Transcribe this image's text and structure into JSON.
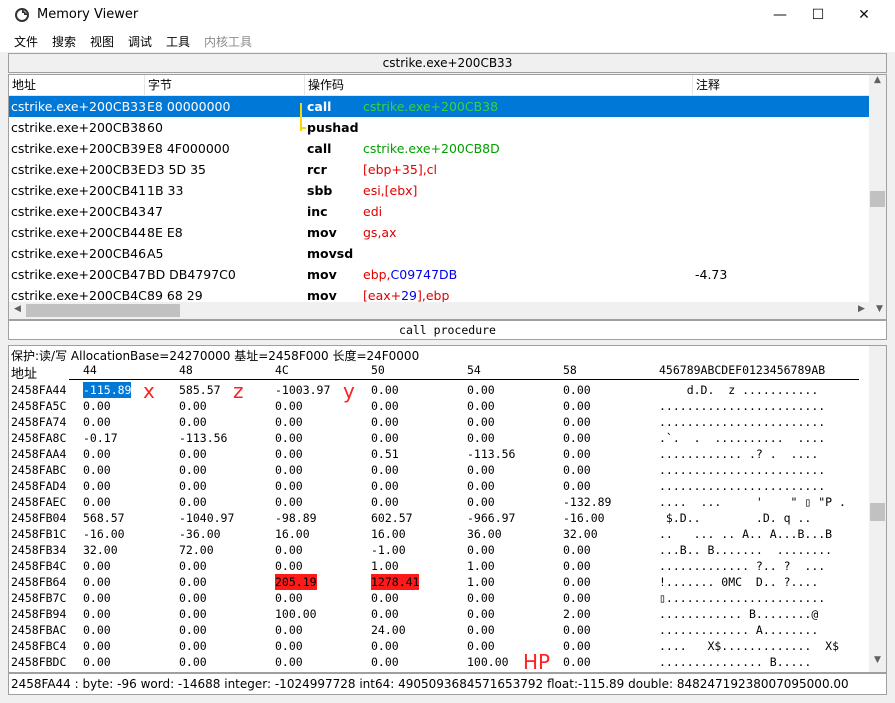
{
  "window": {
    "title": "Memory Viewer",
    "minimize": "—",
    "maximize": "☐",
    "close": "✕"
  },
  "menu": [
    "文件",
    "搜索",
    "视图",
    "调试",
    "工具",
    "内核工具"
  ],
  "disasm": {
    "current_address": "cstrike.exe+200CB33",
    "columns": [
      "地址",
      "字节",
      "操作码",
      "注释"
    ],
    "rows": [
      {
        "addr": "cstrike.exe+200CB33",
        "bytes": "E8 00000000",
        "op": "call",
        "args": "cstrike.exe+200CB38",
        "comment": ""
      },
      {
        "addr": "cstrike.exe+200CB38",
        "bytes": "60",
        "op": "pushad",
        "args": "",
        "comment": ""
      },
      {
        "addr": "cstrike.exe+200CB39",
        "bytes": "E8 4F000000",
        "op": "call",
        "args": "cstrike.exe+200CB8D",
        "comment": ""
      },
      {
        "addr": "cstrike.exe+200CB3E",
        "bytes": "D3 5D 35",
        "op": "rcr",
        "args": "[ebp+35],cl",
        "comment": ""
      },
      {
        "addr": "cstrike.exe+200CB41",
        "bytes": "1B 33",
        "op": "sbb",
        "args": "esi,[ebx]",
        "comment": ""
      },
      {
        "addr": "cstrike.exe+200CB43",
        "bytes": "47",
        "op": "inc",
        "args": "edi",
        "comment": ""
      },
      {
        "addr": "cstrike.exe+200CB44",
        "bytes": "8E E8",
        "op": "mov",
        "args": "gs,ax",
        "comment": ""
      },
      {
        "addr": "cstrike.exe+200CB46",
        "bytes": "A5",
        "op": "movsd",
        "args": "",
        "comment": ""
      },
      {
        "addr": "cstrike.exe+200CB47",
        "bytes": "BD DB4797C0",
        "op": "mov",
        "args": "ebp,C09747DB",
        "comment": "-4.73"
      },
      {
        "addr": "cstrike.exe+200CB4C",
        "bytes": "89 68 29",
        "op": "mov",
        "args": "[eax+29],ebp",
        "comment": ""
      }
    ],
    "status": "call procedure"
  },
  "hex": {
    "info": "保护:读/写  AllocationBase=24270000 基址=2458F000 长度=24F0000",
    "header_label": "地址",
    "header_cols": [
      "44",
      "48",
      "4C",
      "50",
      "54",
      "58"
    ],
    "ascii_header": "456789ABCDEF0123456789AB",
    "rows": [
      {
        "addr": "2458FA44",
        "v": [
          "-115.89",
          "585.57",
          "-1003.97",
          "0.00",
          "0.00",
          "0.00"
        ],
        "ascii": "    d.D.  z ..........."
      },
      {
        "addr": "2458FA5C",
        "v": [
          "0.00",
          "0.00",
          "0.00",
          "0.00",
          "0.00",
          "0.00"
        ],
        "ascii": "........................"
      },
      {
        "addr": "2458FA74",
        "v": [
          "0.00",
          "0.00",
          "0.00",
          "0.00",
          "0.00",
          "0.00"
        ],
        "ascii": "........................"
      },
      {
        "addr": "2458FA8C",
        "v": [
          "-0.17",
          "-113.56",
          "0.00",
          "0.00",
          "0.00",
          "0.00"
        ],
        "ascii": ".`.  .  ..........  ...."
      },
      {
        "addr": "2458FAA4",
        "v": [
          "0.00",
          "0.00",
          "0.00",
          "0.51",
          "-113.56",
          "0.00"
        ],
        "ascii": "............ .? .  ...."
      },
      {
        "addr": "2458FABC",
        "v": [
          "0.00",
          "0.00",
          "0.00",
          "0.00",
          "0.00",
          "0.00"
        ],
        "ascii": "........................"
      },
      {
        "addr": "2458FAD4",
        "v": [
          "0.00",
          "0.00",
          "0.00",
          "0.00",
          "0.00",
          "0.00"
        ],
        "ascii": "........................"
      },
      {
        "addr": "2458FAEC",
        "v": [
          "0.00",
          "0.00",
          "0.00",
          "0.00",
          "0.00",
          "-132.89"
        ],
        "ascii": "....  ...     '    \" ▯ \"P ."
      },
      {
        "addr": "2458FB04",
        "v": [
          "568.57",
          "-1040.97",
          "-98.89",
          "602.57",
          "-966.97",
          "-16.00"
        ],
        "ascii": " $.D..        .D. q .."
      },
      {
        "addr": "2458FB1C",
        "v": [
          "-16.00",
          "-36.00",
          "16.00",
          "16.00",
          "36.00",
          "32.00"
        ],
        "ascii": "..   ... .. A.. A...B...B"
      },
      {
        "addr": "2458FB34",
        "v": [
          "32.00",
          "72.00",
          "0.00",
          "-1.00",
          "0.00",
          "0.00"
        ],
        "ascii": "...B.. B.......  ........"
      },
      {
        "addr": "2458FB4C",
        "v": [
          "0.00",
          "0.00",
          "0.00",
          "1.00",
          "1.00",
          "0.00"
        ],
        "ascii": "............. ?.. ?  ..."
      },
      {
        "addr": "2458FB64",
        "v": [
          "0.00",
          "0.00",
          "205.19",
          "1278.41",
          "1.00",
          "0.00"
        ],
        "ascii": "!....... 0MC  D.. ?...."
      },
      {
        "addr": "2458FB7C",
        "v": [
          "0.00",
          "0.00",
          "0.00",
          "0.00",
          "0.00",
          "0.00"
        ],
        "ascii": "▯......................."
      },
      {
        "addr": "2458FB94",
        "v": [
          "0.00",
          "0.00",
          "100.00",
          "0.00",
          "0.00",
          "2.00"
        ],
        "ascii": "............ B........@"
      },
      {
        "addr": "2458FBAC",
        "v": [
          "0.00",
          "0.00",
          "0.00",
          "24.00",
          "0.00",
          "0.00"
        ],
        "ascii": "............. A........"
      },
      {
        "addr": "2458FBC4",
        "v": [
          "0.00",
          "0.00",
          "0.00",
          "0.00",
          "0.00",
          "0.00"
        ],
        "ascii": "....   X$.............  X$"
      },
      {
        "addr": "2458FBDC",
        "v": [
          "0.00",
          "0.00",
          "0.00",
          "0.00",
          "100.00",
          "0.00"
        ],
        "ascii": "............... B....."
      }
    ],
    "annotations": {
      "x": "x",
      "z": "z",
      "y": "y",
      "hp": "HP"
    }
  },
  "bottom_status": "2458FA44 : byte: -96 word: -14688 integer: -1024997728 int64: 4905093684571653792 float:-115.89 double: 84824719238007095000.00",
  "colors": {
    "selection": "#0078d7",
    "highlight_red": "#ff1a1a",
    "annotation": "#ff2020",
    "register": "#e00000",
    "constant": "#0000ee",
    "address": "#00a000"
  }
}
